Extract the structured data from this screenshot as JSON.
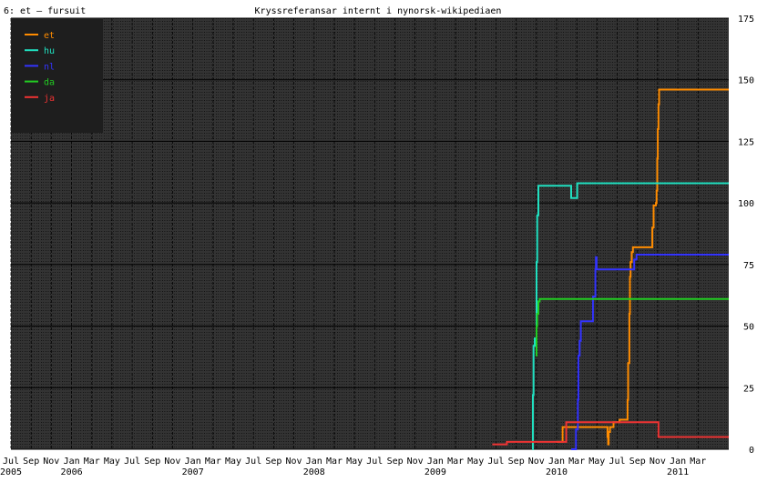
{
  "header": {
    "left_label": "6: et – fursuit",
    "title": "Kryssreferansar internt i nynorsk-wikipediaen"
  },
  "colors": {
    "plot_bg": "#333333",
    "grid_minor": "#000000",
    "grid_major": "#000000",
    "legend_bg": "#1e1e1e",
    "et": "#ff8c00",
    "hu": "#20e0c0",
    "nl": "#3333ff",
    "da": "#22cc22",
    "ja": "#ee3333"
  },
  "chart_data": {
    "type": "line",
    "title": "Kryssreferansar internt i nynorsk-wikipediaen",
    "xlabel": "",
    "ylabel": "",
    "xlim": [
      2005.5,
      2011.42
    ],
    "ylim": [
      0,
      175
    ],
    "y_ticks": [
      0,
      25,
      50,
      75,
      100,
      125,
      150,
      175
    ],
    "month_ticks": [
      {
        "t": 2005.5,
        "label": "Jul"
      },
      {
        "t": 2005.667,
        "label": "Sep"
      },
      {
        "t": 2005.833,
        "label": "Nov"
      },
      {
        "t": 2006.0,
        "label": "Jan"
      },
      {
        "t": 2006.167,
        "label": "Mar"
      },
      {
        "t": 2006.333,
        "label": "May"
      },
      {
        "t": 2006.5,
        "label": "Jul"
      },
      {
        "t": 2006.667,
        "label": "Sep"
      },
      {
        "t": 2006.833,
        "label": "Nov"
      },
      {
        "t": 2007.0,
        "label": "Jan"
      },
      {
        "t": 2007.167,
        "label": "Mar"
      },
      {
        "t": 2007.333,
        "label": "May"
      },
      {
        "t": 2007.5,
        "label": "Jul"
      },
      {
        "t": 2007.667,
        "label": "Sep"
      },
      {
        "t": 2007.833,
        "label": "Nov"
      },
      {
        "t": 2008.0,
        "label": "Jan"
      },
      {
        "t": 2008.167,
        "label": "Mar"
      },
      {
        "t": 2008.333,
        "label": "May"
      },
      {
        "t": 2008.5,
        "label": "Jul"
      },
      {
        "t": 2008.667,
        "label": "Sep"
      },
      {
        "t": 2008.833,
        "label": "Nov"
      },
      {
        "t": 2009.0,
        "label": "Jan"
      },
      {
        "t": 2009.167,
        "label": "Mar"
      },
      {
        "t": 2009.333,
        "label": "May"
      },
      {
        "t": 2009.5,
        "label": "Jul"
      },
      {
        "t": 2009.667,
        "label": "Sep"
      },
      {
        "t": 2009.833,
        "label": "Nov"
      },
      {
        "t": 2010.0,
        "label": "Jan"
      },
      {
        "t": 2010.167,
        "label": "Mar"
      },
      {
        "t": 2010.333,
        "label": "May"
      },
      {
        "t": 2010.5,
        "label": "Jul"
      },
      {
        "t": 2010.667,
        "label": "Sep"
      },
      {
        "t": 2010.833,
        "label": "Nov"
      },
      {
        "t": 2011.0,
        "label": "Jan"
      },
      {
        "t": 2011.167,
        "label": "Mar"
      }
    ],
    "year_ticks": [
      {
        "t": 2005.5,
        "label": "2005"
      },
      {
        "t": 2006.0,
        "label": "2006"
      },
      {
        "t": 2007.0,
        "label": "2007"
      },
      {
        "t": 2008.0,
        "label": "2008"
      },
      {
        "t": 2009.0,
        "label": "2009"
      },
      {
        "t": 2010.0,
        "label": "2010"
      },
      {
        "t": 2011.0,
        "label": "2011"
      }
    ],
    "legend_position": "top-left",
    "series": [
      {
        "name": "et",
        "color_key": "et",
        "points": [
          [
            2010.0,
            3
          ],
          [
            2010.05,
            9
          ],
          [
            2010.4,
            9
          ],
          [
            2010.42,
            5
          ],
          [
            2010.425,
            2
          ],
          [
            2010.43,
            7
          ],
          [
            2010.44,
            9
          ],
          [
            2010.47,
            11
          ],
          [
            2010.5,
            11
          ],
          [
            2010.52,
            12
          ],
          [
            2010.58,
            12
          ],
          [
            2010.585,
            20
          ],
          [
            2010.59,
            35
          ],
          [
            2010.6,
            55
          ],
          [
            2010.605,
            70
          ],
          [
            2010.61,
            76
          ],
          [
            2010.62,
            80
          ],
          [
            2010.63,
            82
          ],
          [
            2010.78,
            82
          ],
          [
            2010.79,
            90
          ],
          [
            2010.8,
            99
          ],
          [
            2010.82,
            100
          ],
          [
            2010.825,
            105
          ],
          [
            2010.83,
            118
          ],
          [
            2010.835,
            130
          ],
          [
            2010.84,
            140
          ],
          [
            2010.845,
            146
          ],
          [
            2011.42,
            146
          ]
        ]
      },
      {
        "name": "hu",
        "color_key": "hu",
        "points": [
          [
            2009.8,
            0
          ],
          [
            2009.805,
            22
          ],
          [
            2009.81,
            42
          ],
          [
            2009.82,
            45
          ],
          [
            2009.83,
            45
          ],
          [
            2009.835,
            76
          ],
          [
            2009.84,
            95
          ],
          [
            2009.85,
            107
          ],
          [
            2010.1,
            107
          ],
          [
            2010.12,
            102
          ],
          [
            2010.15,
            102
          ],
          [
            2010.17,
            108
          ],
          [
            2011.42,
            108
          ]
        ]
      },
      {
        "name": "nl",
        "color_key": "nl",
        "points": [
          [
            2010.12,
            0
          ],
          [
            2010.15,
            0
          ],
          [
            2010.16,
            8
          ],
          [
            2010.175,
            20
          ],
          [
            2010.18,
            38
          ],
          [
            2010.19,
            44
          ],
          [
            2010.2,
            52
          ],
          [
            2010.29,
            52
          ],
          [
            2010.3,
            62
          ],
          [
            2010.32,
            73
          ],
          [
            2010.325,
            78
          ],
          [
            2010.33,
            73
          ],
          [
            2010.63,
            73
          ],
          [
            2010.64,
            77
          ],
          [
            2010.66,
            79
          ],
          [
            2011.42,
            79
          ]
        ]
      },
      {
        "name": "da",
        "color_key": "da",
        "points": [
          [
            2009.83,
            38
          ],
          [
            2009.835,
            50
          ],
          [
            2009.84,
            55
          ],
          [
            2009.85,
            60
          ],
          [
            2009.86,
            61
          ],
          [
            2011.42,
            61
          ]
        ]
      },
      {
        "name": "ja",
        "color_key": "ja",
        "points": [
          [
            2009.47,
            2
          ],
          [
            2009.58,
            2
          ],
          [
            2009.59,
            3
          ],
          [
            2010.07,
            3
          ],
          [
            2010.08,
            11
          ],
          [
            2010.83,
            11
          ],
          [
            2010.84,
            5
          ],
          [
            2011.42,
            5
          ]
        ]
      }
    ]
  }
}
